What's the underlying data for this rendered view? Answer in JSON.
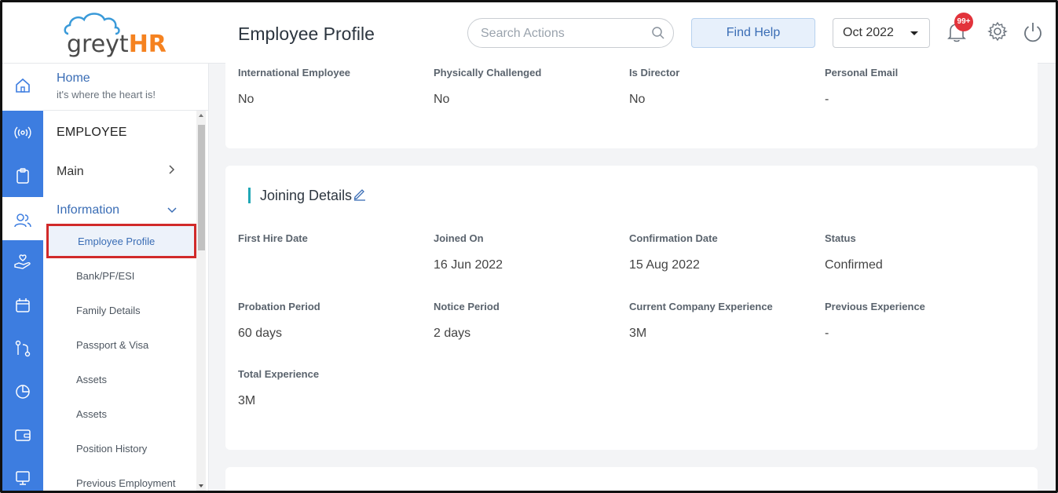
{
  "header": {
    "logo_text_a": "greyt",
    "logo_text_b": "HR",
    "page_title": "Employee Profile",
    "search_placeholder": "Search Actions",
    "find_help_label": "Find Help",
    "month_value": "Oct 2022",
    "notification_badge": "99+"
  },
  "rail": {
    "icons": [
      "home-icon",
      "broadcast-icon",
      "clipboard-icon",
      "people-icon",
      "hand-heart-icon",
      "calendar-icon",
      "workflow-icon",
      "pie-chart-icon",
      "wallet-icon",
      "monitor-icon"
    ]
  },
  "sidebar": {
    "home_title": "Home",
    "home_subtitle": "it's where the heart is!",
    "section_title": "EMPLOYEE",
    "main_label": "Main",
    "information_label": "Information",
    "items": [
      {
        "label": "Employee Profile",
        "active": true
      },
      {
        "label": "Bank/PF/ESI"
      },
      {
        "label": "Family Details"
      },
      {
        "label": "Passport & Visa"
      },
      {
        "label": "Assets"
      },
      {
        "label": "Assets"
      },
      {
        "label": "Position History"
      },
      {
        "label": "Previous Employment"
      }
    ]
  },
  "personal": {
    "fields": [
      {
        "label": "International Employee",
        "value": "No"
      },
      {
        "label": "Physically Challenged",
        "value": "No"
      },
      {
        "label": "Is Director",
        "value": "No"
      },
      {
        "label": "Personal Email",
        "value": "-"
      }
    ]
  },
  "joining": {
    "title": "Joining Details",
    "fields": [
      {
        "label": "First Hire Date",
        "value": ""
      },
      {
        "label": "Joined On",
        "value": "16 Jun 2022"
      },
      {
        "label": "Confirmation Date",
        "value": "15 Aug 2022"
      },
      {
        "label": "Status",
        "value": "Confirmed"
      },
      {
        "label": "Probation Period",
        "value": "60 days"
      },
      {
        "label": "Notice Period",
        "value": "2 days"
      },
      {
        "label": "Current Company Experience",
        "value": "3M"
      },
      {
        "label": "Previous Experience",
        "value": "-"
      },
      {
        "label": "Total Experience",
        "value": "3M"
      }
    ]
  },
  "colors": {
    "accent_blue": "#3d7de0",
    "link_blue": "#3a6db5",
    "badge_red": "#e2333b",
    "highlight_red": "#d12a2a",
    "brand_orange": "#f58220",
    "section_teal": "#20a7b5"
  }
}
